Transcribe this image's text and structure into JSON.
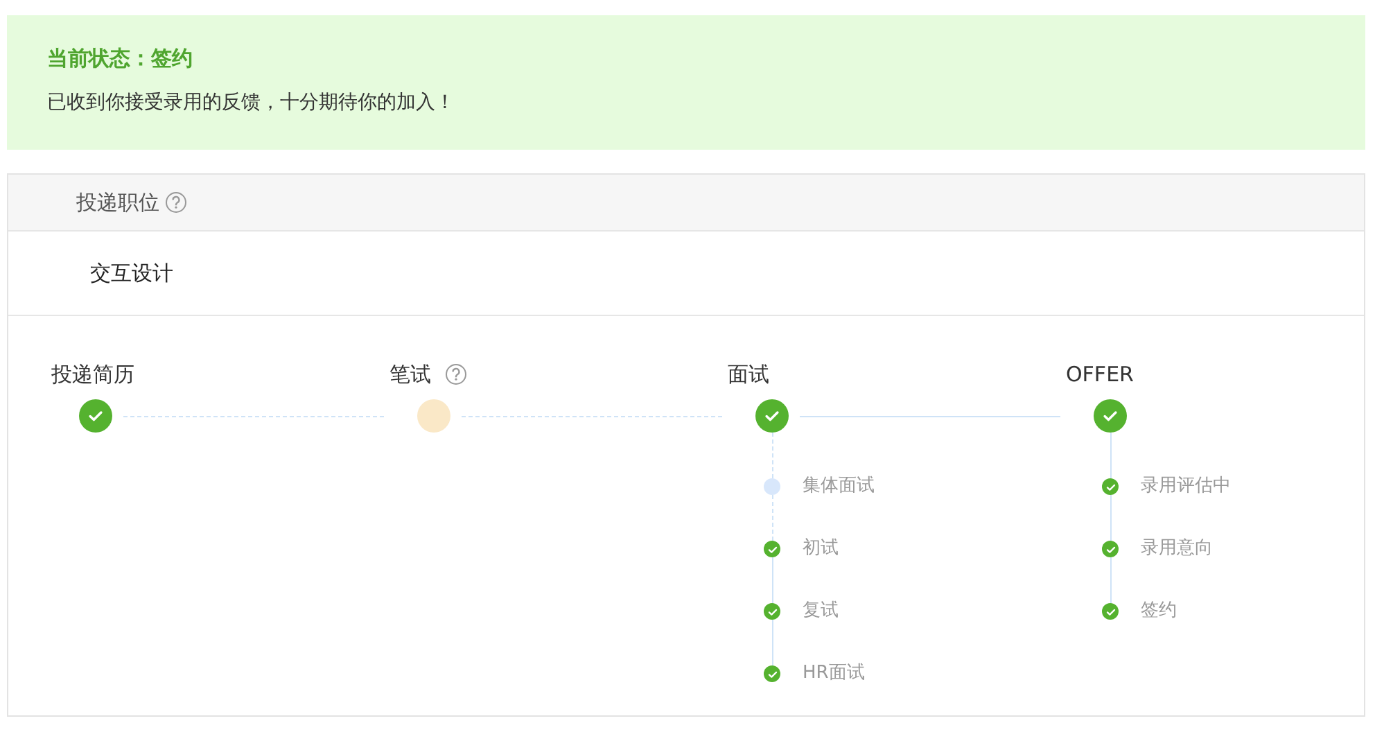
{
  "alert": {
    "title": "当前状态：签约",
    "message": "已收到你接受录用的反馈，十分期待你的加入！"
  },
  "position": {
    "header": "投递职位",
    "help": true,
    "value": "交互设计"
  },
  "steps": [
    {
      "label": "投递简历",
      "done": true,
      "help": false
    },
    {
      "label": "笔试",
      "done": false,
      "help": true
    },
    {
      "label": "面试",
      "done": true,
      "help": false,
      "substeps": [
        {
          "label": "集体面试",
          "done": false
        },
        {
          "label": "初试",
          "done": true
        },
        {
          "label": "复试",
          "done": true
        },
        {
          "label": "HR面试",
          "done": true
        }
      ]
    },
    {
      "label": "OFFER",
      "done": true,
      "help": false,
      "substeps": [
        {
          "label": "录用评估中",
          "done": true
        },
        {
          "label": "录用意向",
          "done": true
        },
        {
          "label": "签约",
          "done": true
        }
      ]
    }
  ]
}
